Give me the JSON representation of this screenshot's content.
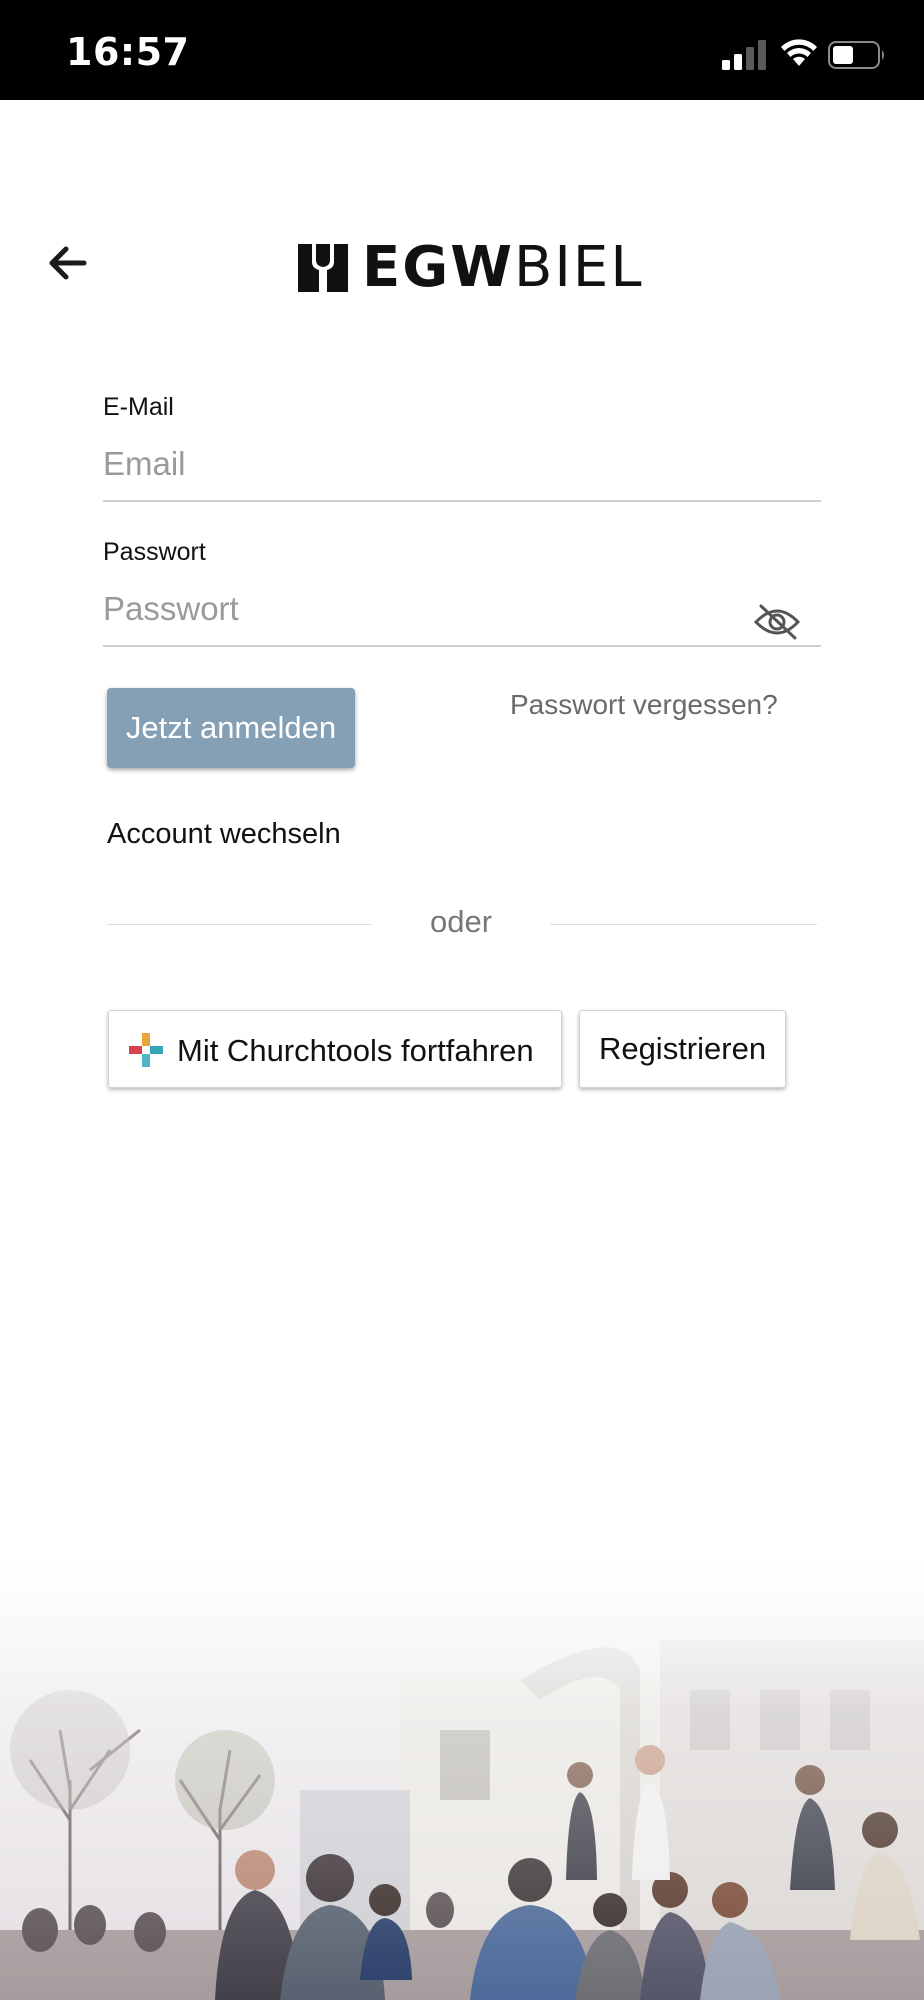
{
  "status_bar": {
    "time": "16:57"
  },
  "header": {
    "logo": {
      "text_bold": "EGW",
      "text_light": "BIEL"
    }
  },
  "form": {
    "email": {
      "label": "E-Mail",
      "placeholder": "Email",
      "value": ""
    },
    "password": {
      "label": "Passwort",
      "placeholder": "Passwort",
      "value": ""
    },
    "login_button": "Jetzt anmelden",
    "forgot_password": "Passwort vergessen?",
    "switch_account": "Account wechseln",
    "divider_text": "oder",
    "churchtools_button": "Mit Churchtools fortfahren",
    "register_button": "Registrieren"
  },
  "colors": {
    "login_button_bg": "#85a0b5",
    "status_bar_bg": "#000000"
  },
  "icons": {
    "back": "arrow-left-icon",
    "password_visibility": "eye-off-icon",
    "churchtools": "churchtools-logo-icon"
  }
}
